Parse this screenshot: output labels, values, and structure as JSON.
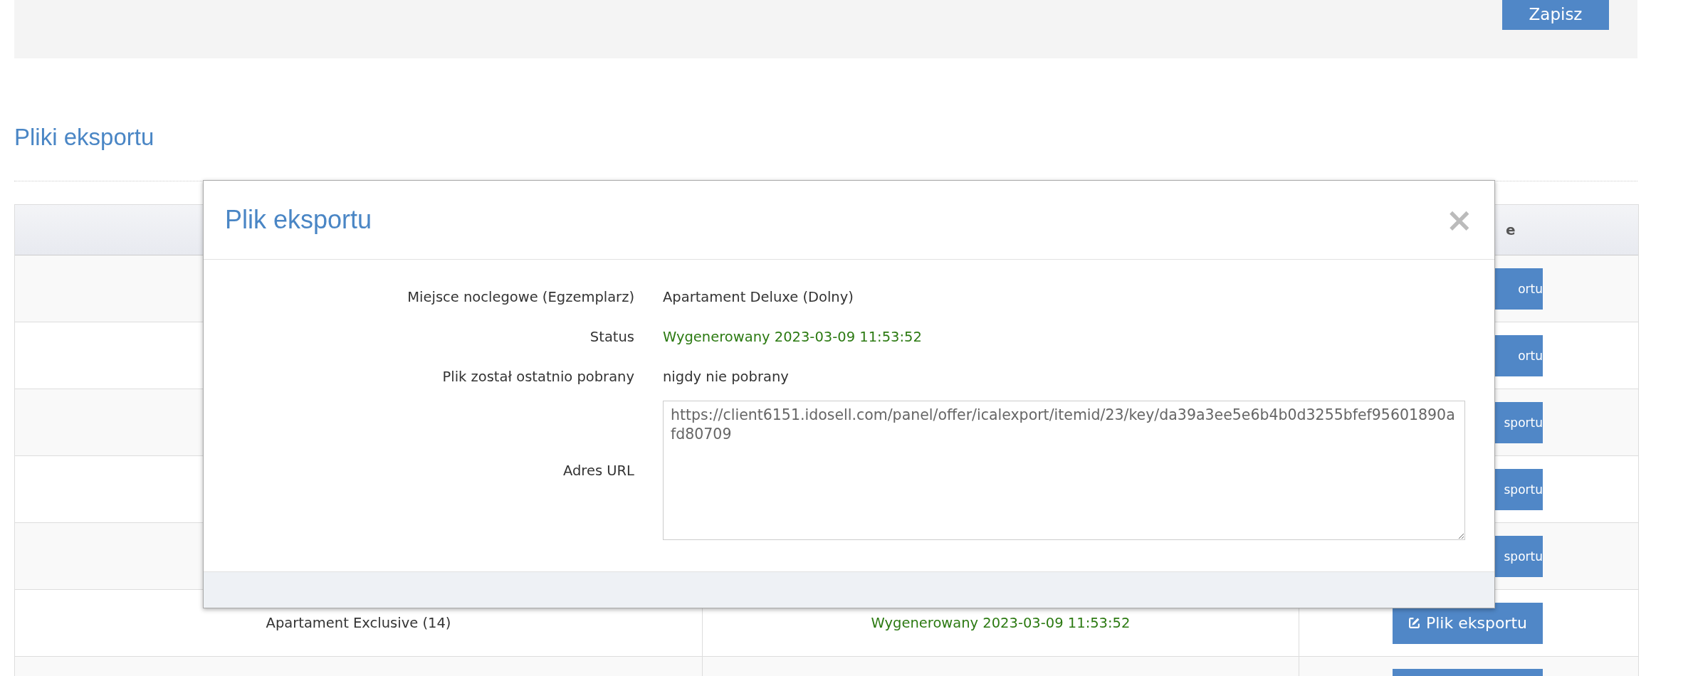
{
  "top_panel": {
    "save_button": "Zapisz"
  },
  "section_title": "Pliki eksportu",
  "table": {
    "header": {
      "column_3": "e"
    },
    "rows": [
      {
        "kind": "covered",
        "button": "ortu"
      },
      {
        "kind": "covered",
        "button": "ortu"
      },
      {
        "kind": "covered",
        "button": "sportu"
      },
      {
        "kind": "covered",
        "button": "sportu"
      },
      {
        "kind": "covered",
        "button": "sportu"
      },
      {
        "kind": "full",
        "name": "Apartament Exclusive (14)",
        "status": "Wygenerowany 2023-03-09 11:53:52",
        "button": "Plik eksportu"
      },
      {
        "kind": "cut"
      }
    ]
  },
  "modal": {
    "title": "Plik eksportu",
    "close": "×",
    "fields": [
      {
        "kind": "text",
        "label": "Miejsce noclegowe (Egzemplarz)",
        "value": "Apartament Deluxe (Dolny)"
      },
      {
        "kind": "status",
        "label": "Status",
        "value": "Wygenerowany 2023-03-09 11:53:52"
      },
      {
        "kind": "text",
        "label": "Plik został ostatnio pobrany",
        "value": "nigdy nie pobrany"
      },
      {
        "kind": "textarea",
        "label": "Adres URL",
        "value": "https://client6151.idosell.com/panel/offer/icalexport/itemid/23/key/da39a3ee5e6b4b0d3255bfef95601890afd80709"
      }
    ]
  }
}
